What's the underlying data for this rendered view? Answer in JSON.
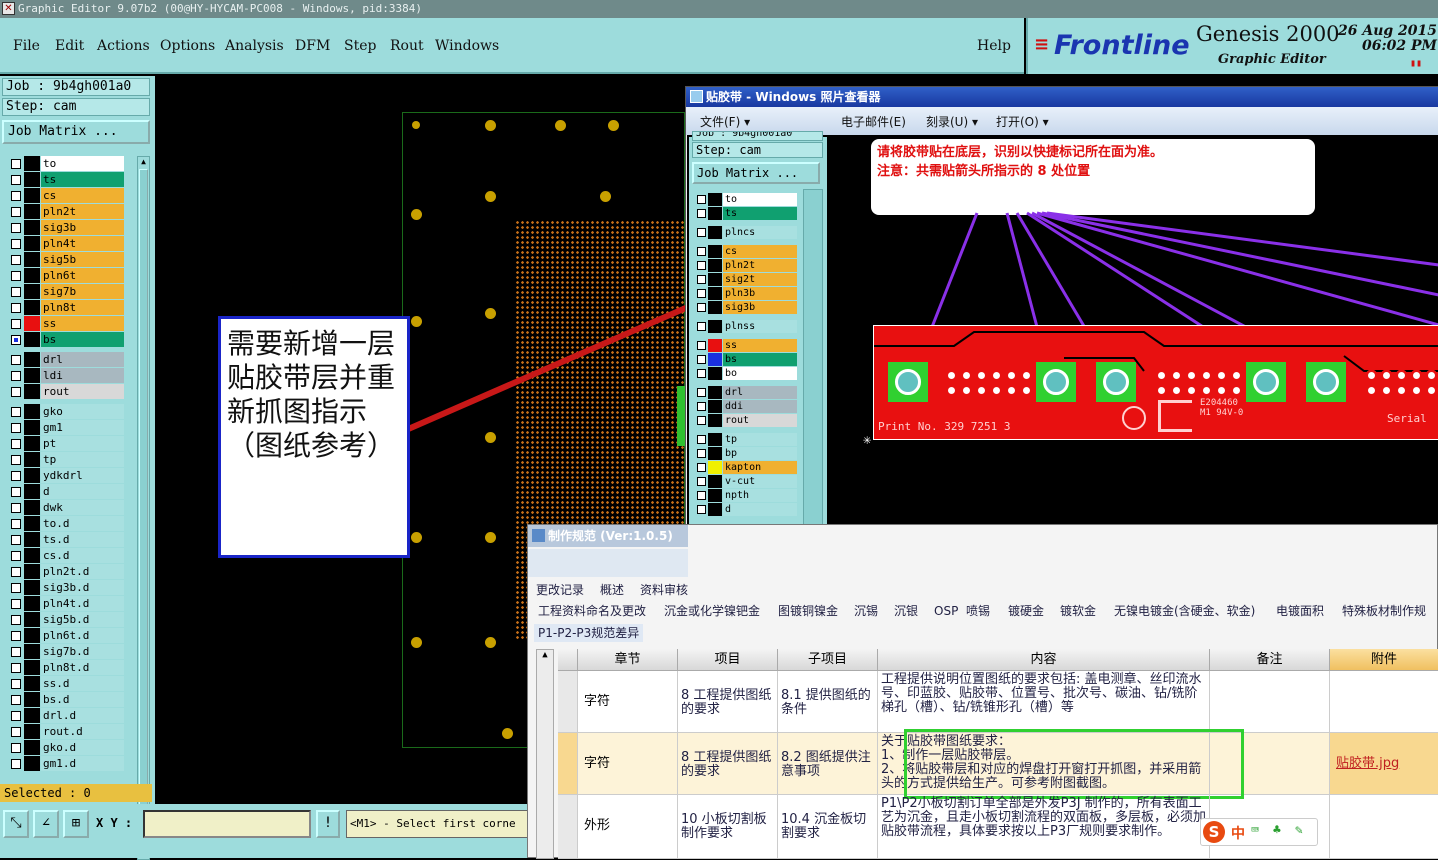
{
  "title_bar": {
    "text": "Graphic Editor 9.07b2 (00@HY-HYCAM-PC008 - Windows, pid:3384)",
    "icon": "app-x-icon"
  },
  "menu": [
    "File",
    "Edit",
    "Actions",
    "Options",
    "Analysis",
    "DFM",
    "Step",
    "Rout",
    "Windows"
  ],
  "help": "Help",
  "logo": {
    "brand": "Frontline",
    "product": "Genesis 2000",
    "sub": "Graphic Editor",
    "date": "26 Aug 2015",
    "time": "06:02 PM"
  },
  "job": {
    "job_label": "Job : 9b4gh001a0",
    "step_label": "Step: cam",
    "matrix_button": "Job Matrix ..."
  },
  "layers": [
    {
      "name": "to",
      "color": "#ffffff",
      "sw": "#000000",
      "checked": false
    },
    {
      "name": "ts",
      "color": "#10a070",
      "sw": "#000000",
      "checked": false
    },
    {
      "name": "cs",
      "color": "#f0b030",
      "sw": "#000000",
      "checked": false
    },
    {
      "name": "pln2t",
      "color": "#f0b030",
      "sw": "#000000",
      "checked": false
    },
    {
      "name": "sig3b",
      "color": "#f0b030",
      "sw": "#000000",
      "checked": false
    },
    {
      "name": "pln4t",
      "color": "#f0b030",
      "sw": "#000000",
      "checked": false
    },
    {
      "name": "sig5b",
      "color": "#f0b030",
      "sw": "#000000",
      "checked": false
    },
    {
      "name": "pln6t",
      "color": "#f0b030",
      "sw": "#000000",
      "checked": false
    },
    {
      "name": "sig7b",
      "color": "#f0b030",
      "sw": "#000000",
      "checked": false
    },
    {
      "name": "pln8t",
      "color": "#f0b030",
      "sw": "#000000",
      "checked": false
    },
    {
      "name": "ss",
      "color": "#f0b030",
      "sw": "#e81010",
      "checked": false
    },
    {
      "name": "bs",
      "color": "#10a070",
      "sw": "#000000",
      "checked": true
    },
    {
      "name": "drl",
      "color": "#a8b8c0",
      "sw": "#000000",
      "checked": false
    },
    {
      "name": "ldi",
      "color": "#a8b8c0",
      "sw": "#000000",
      "checked": false
    },
    {
      "name": "rout",
      "color": "#d8d8d8",
      "sw": "#000000",
      "checked": false
    },
    {
      "name": "gko",
      "color": "#a8e0e0",
      "sw": "#000000",
      "checked": false
    },
    {
      "name": "gm1",
      "color": "#a8e0e0",
      "sw": "#000000",
      "checked": false
    },
    {
      "name": "pt",
      "color": "#a8e0e0",
      "sw": "#000000",
      "checked": false
    },
    {
      "name": "tp",
      "color": "#a8e0e0",
      "sw": "#000000",
      "checked": false
    },
    {
      "name": "ydkdrl",
      "color": "#a8e0e0",
      "sw": "#000000",
      "checked": false
    },
    {
      "name": "d",
      "color": "#a8e0e0",
      "sw": "#000000",
      "checked": false
    },
    {
      "name": "dwk",
      "color": "#a8e0e0",
      "sw": "#000000",
      "checked": false
    },
    {
      "name": "to.d",
      "color": "#a8e0e0",
      "sw": "#000000",
      "checked": false
    },
    {
      "name": "ts.d",
      "color": "#a8e0e0",
      "sw": "#000000",
      "checked": false
    },
    {
      "name": "cs.d",
      "color": "#a8e0e0",
      "sw": "#000000",
      "checked": false
    },
    {
      "name": "pln2t.d",
      "color": "#a8e0e0",
      "sw": "#000000",
      "checked": false
    },
    {
      "name": "sig3b.d",
      "color": "#a8e0e0",
      "sw": "#000000",
      "checked": false
    },
    {
      "name": "pln4t.d",
      "color": "#a8e0e0",
      "sw": "#000000",
      "checked": false
    },
    {
      "name": "sig5b.d",
      "color": "#a8e0e0",
      "sw": "#000000",
      "checked": false
    },
    {
      "name": "pln6t.d",
      "color": "#a8e0e0",
      "sw": "#000000",
      "checked": false
    },
    {
      "name": "sig7b.d",
      "color": "#a8e0e0",
      "sw": "#000000",
      "checked": false
    },
    {
      "name": "pln8t.d",
      "color": "#a8e0e0",
      "sw": "#000000",
      "checked": false
    },
    {
      "name": "ss.d",
      "color": "#a8e0e0",
      "sw": "#000000",
      "checked": false
    },
    {
      "name": "bs.d",
      "color": "#a8e0e0",
      "sw": "#000000",
      "checked": false
    },
    {
      "name": "drl.d",
      "color": "#a8e0e0",
      "sw": "#000000",
      "checked": false
    },
    {
      "name": "rout.d",
      "color": "#a8e0e0",
      "sw": "#000000",
      "checked": false
    },
    {
      "name": "gko.d",
      "color": "#a8e0e0",
      "sw": "#000000",
      "checked": false
    },
    {
      "name": "gm1.d",
      "color": "#a8e0e0",
      "sw": "#000000",
      "checked": false
    }
  ],
  "selected": "Selected : 0",
  "xy_label": "X Y :",
  "command_text": "<M1> - Select first corne",
  "callout": "需要新增一层贴胶带层并重新抓图指示（图纸参考）",
  "viewer": {
    "title": "贴胶带 - Windows 照片查看器",
    "menu": [
      "文件(F) ▾",
      "电子邮件(E)",
      "刻录(U) ▾",
      "打开(O) ▾"
    ],
    "job_partial": "Job : 9b4gh001a0",
    "step_label": "Step: cam",
    "matrix_button": "Job Matrix ...",
    "layers": [
      {
        "name": "to",
        "color": "#ffffff",
        "sw": "#000000"
      },
      {
        "name": "ts",
        "color": "#10a070",
        "sw": "#000000"
      },
      {
        "name": "plncs",
        "color": "#a8e0e0",
        "sw": "#000000"
      },
      {
        "name": "cs",
        "color": "#f0b030",
        "sw": "#000000"
      },
      {
        "name": "pln2t",
        "color": "#f0b030",
        "sw": "#000000"
      },
      {
        "name": "sig2t",
        "color": "#f0b030",
        "sw": "#000000"
      },
      {
        "name": "pln3b",
        "color": "#f0b030",
        "sw": "#000000"
      },
      {
        "name": "sig3b",
        "color": "#f0b030",
        "sw": "#000000"
      },
      {
        "name": "plnss",
        "color": "#a8e0e0",
        "sw": "#000000"
      },
      {
        "name": "ss",
        "color": "#f0b030",
        "sw": "#e81010"
      },
      {
        "name": "bs",
        "color": "#10a070",
        "sw": "#1a30e0"
      },
      {
        "name": "bo",
        "color": "#ffffff",
        "sw": "#000000"
      },
      {
        "name": "drl",
        "color": "#a8b8c0",
        "sw": "#000000"
      },
      {
        "name": "ddi",
        "color": "#a8b8c0",
        "sw": "#000000"
      },
      {
        "name": "rout",
        "color": "#d8d8d8",
        "sw": "#000000"
      },
      {
        "name": "tp",
        "color": "#a8e0e0",
        "sw": "#000000"
      },
      {
        "name": "bp",
        "color": "#a8e0e0",
        "sw": "#000000"
      },
      {
        "name": "kapton",
        "color": "#f0b030",
        "sw": "#f0f000"
      },
      {
        "name": "v-cut",
        "color": "#a8e0e0",
        "sw": "#000000"
      },
      {
        "name": "npth",
        "color": "#a8e0e0",
        "sw": "#000000"
      },
      {
        "name": "d",
        "color": "#a8e0e0",
        "sw": "#000000"
      }
    ],
    "annotation_line1": "请将胶带贴在底层，识别以快捷标记所在面为准。",
    "annotation_line2": "注意：共需贴箭头所指示的 8 处位置",
    "pcb_text": "Print No. 329 7251 3",
    "pcb_text2": "Serial",
    "pcb_text3": "E204460",
    "pcb_text4": "M1 94V-0"
  },
  "spec": {
    "title": "制作规范 (Ver:1.0.5)",
    "tabs_row1": [
      "更改记录",
      "概述",
      "资料审核"
    ],
    "tabs_row2": [
      "工程资料命名及更改",
      "沉金或化学镍钯金",
      "图镀铜镍金",
      "沉锡",
      "沉银",
      "OSP",
      "喷锡",
      "镀硬金",
      "镀软金",
      "无镍电镀金(含硬金、软金)",
      "电镀面积",
      "特殊板材制作规"
    ],
    "tabs_row3": [
      "P1-P2-P3规范差异"
    ],
    "columns": [
      "章节",
      "项目",
      "子项目",
      "内容",
      "备注",
      "附件"
    ],
    "rows": [
      {
        "chapter": "字符",
        "item": "8 工程提供图纸的要求",
        "sub": "8.1 提供图纸的条件",
        "content": "工程提供说明位置图纸的要求包括: 盖电测章、丝印流水号、印蓝胶、贴胶带、位置号、批次号、碳油、钻/铣阶梯孔（槽）、钻/铣锥形孔（槽）等",
        "remark": "",
        "attach": ""
      },
      {
        "chapter": "字符",
        "item": "8 工程提供图纸的要求",
        "sub": "8.2 图纸提供注意事项",
        "content": "关于贴胶带图纸要求：\n1、制作一层贴胶带层。\n2、将贴胶带层和对应的焊盘打开窗打开抓图，并采用箭头的方式提供给生产。可参考附图截图。",
        "remark": "",
        "attach": "贴胶带.jpg"
      },
      {
        "chapter": "外形",
        "item": "10 小板切割板制作要求",
        "sub": "10.4 沉金板切割要求",
        "content": "P1\\P2小板切割订单全部是外发P3J 制作的，所有表面工艺为沉金，且走小板切割流程的双面板，多层板，必须加贴胶带流程，具体要求按以上P3厂规则要求制作。",
        "remark": "",
        "attach": ""
      }
    ]
  },
  "ime": {
    "label": "中"
  }
}
